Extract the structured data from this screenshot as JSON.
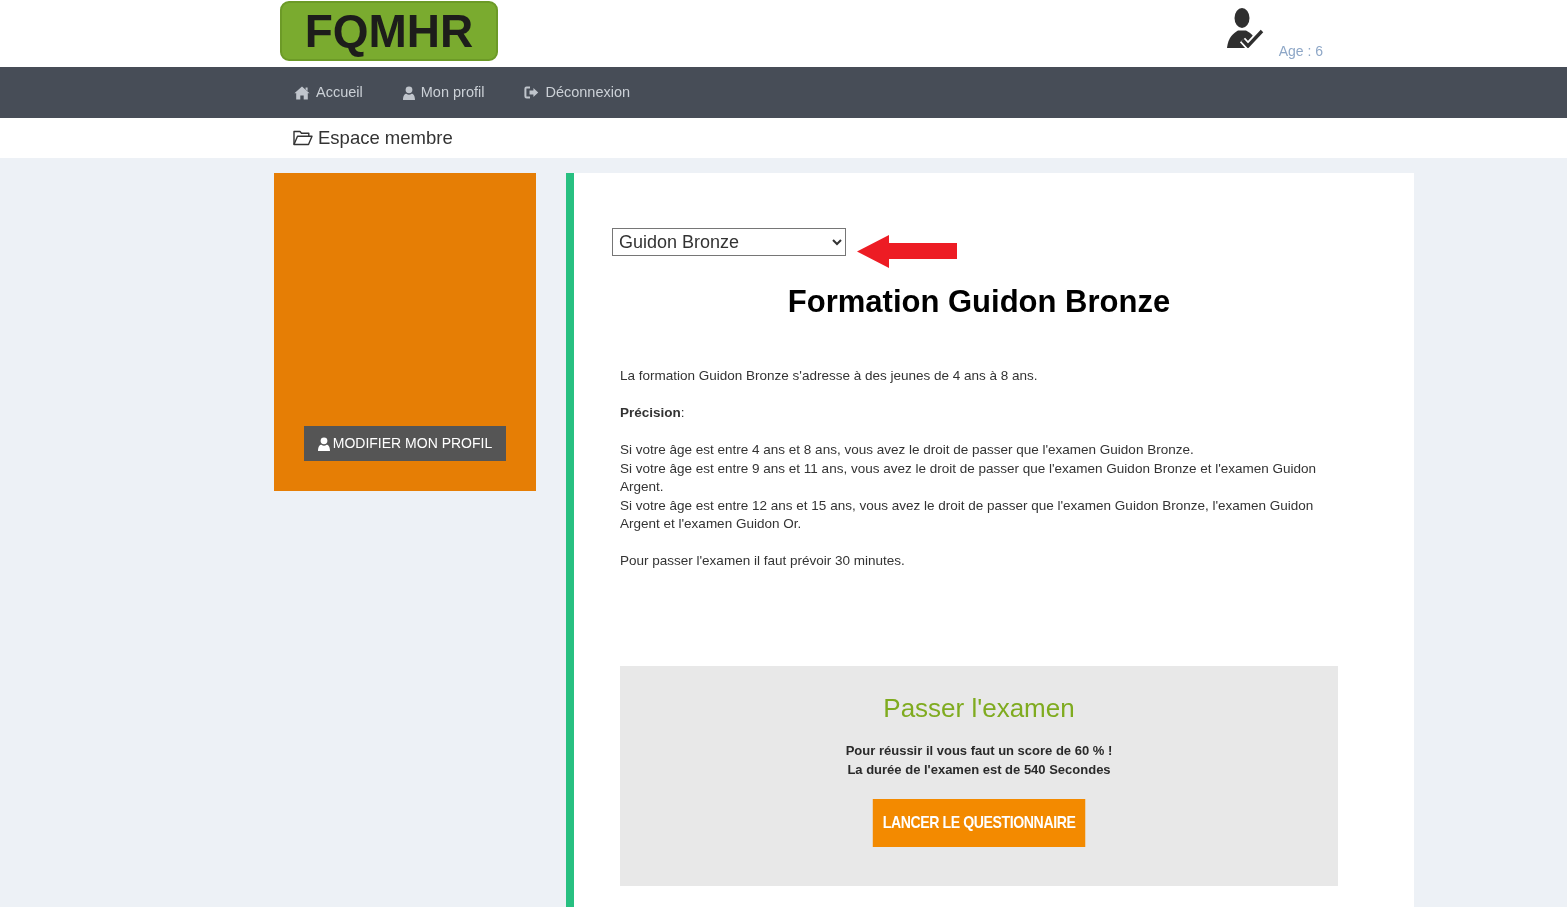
{
  "header": {
    "logo": "FQMHR",
    "age": "Age : 6"
  },
  "nav": [
    {
      "label": "Accueil"
    },
    {
      "label": "Mon profil"
    },
    {
      "label": "Déconnexion"
    }
  ],
  "breadcrumb": {
    "label": "Espace membre"
  },
  "sidebar": {
    "button": "MODIFIER MON PROFIL"
  },
  "content": {
    "course_select": {
      "value": "Guidon Bronze"
    },
    "title": "Formation Guidon Bronze",
    "paragraphs": [
      [
        "La formation Guidon Bronze s'adresse à des jeunes de 4 ans à 8 ans."
      ],
      [
        "**Précision**:"
      ],
      [
        "Si votre âge est entre 4 ans et 8 ans, vous avez le droit de passer que l'examen Guidon Bronze.",
        "Si votre âge est entre 9 ans et 11 ans, vous avez le droit de passer que l'examen Guidon Bronze et l'examen Guidon Argent.",
        "Si votre âge est entre 12 ans et 15 ans, vous avez le droit de passer que l'examen Guidon Bronze, l'examen Guidon Argent et l'examen Guidon Or."
      ],
      [
        "Pour passer l'examen il faut prévoir 30 minutes."
      ]
    ]
  },
  "exam": {
    "title": "Passer l'examen",
    "lines": [
      "Pour réussir il vous faut un score de 60 % !",
      "La durée de l'examen est de 540 Secondes"
    ],
    "button": "LANCER LE QUESTIONNAIRE"
  }
}
